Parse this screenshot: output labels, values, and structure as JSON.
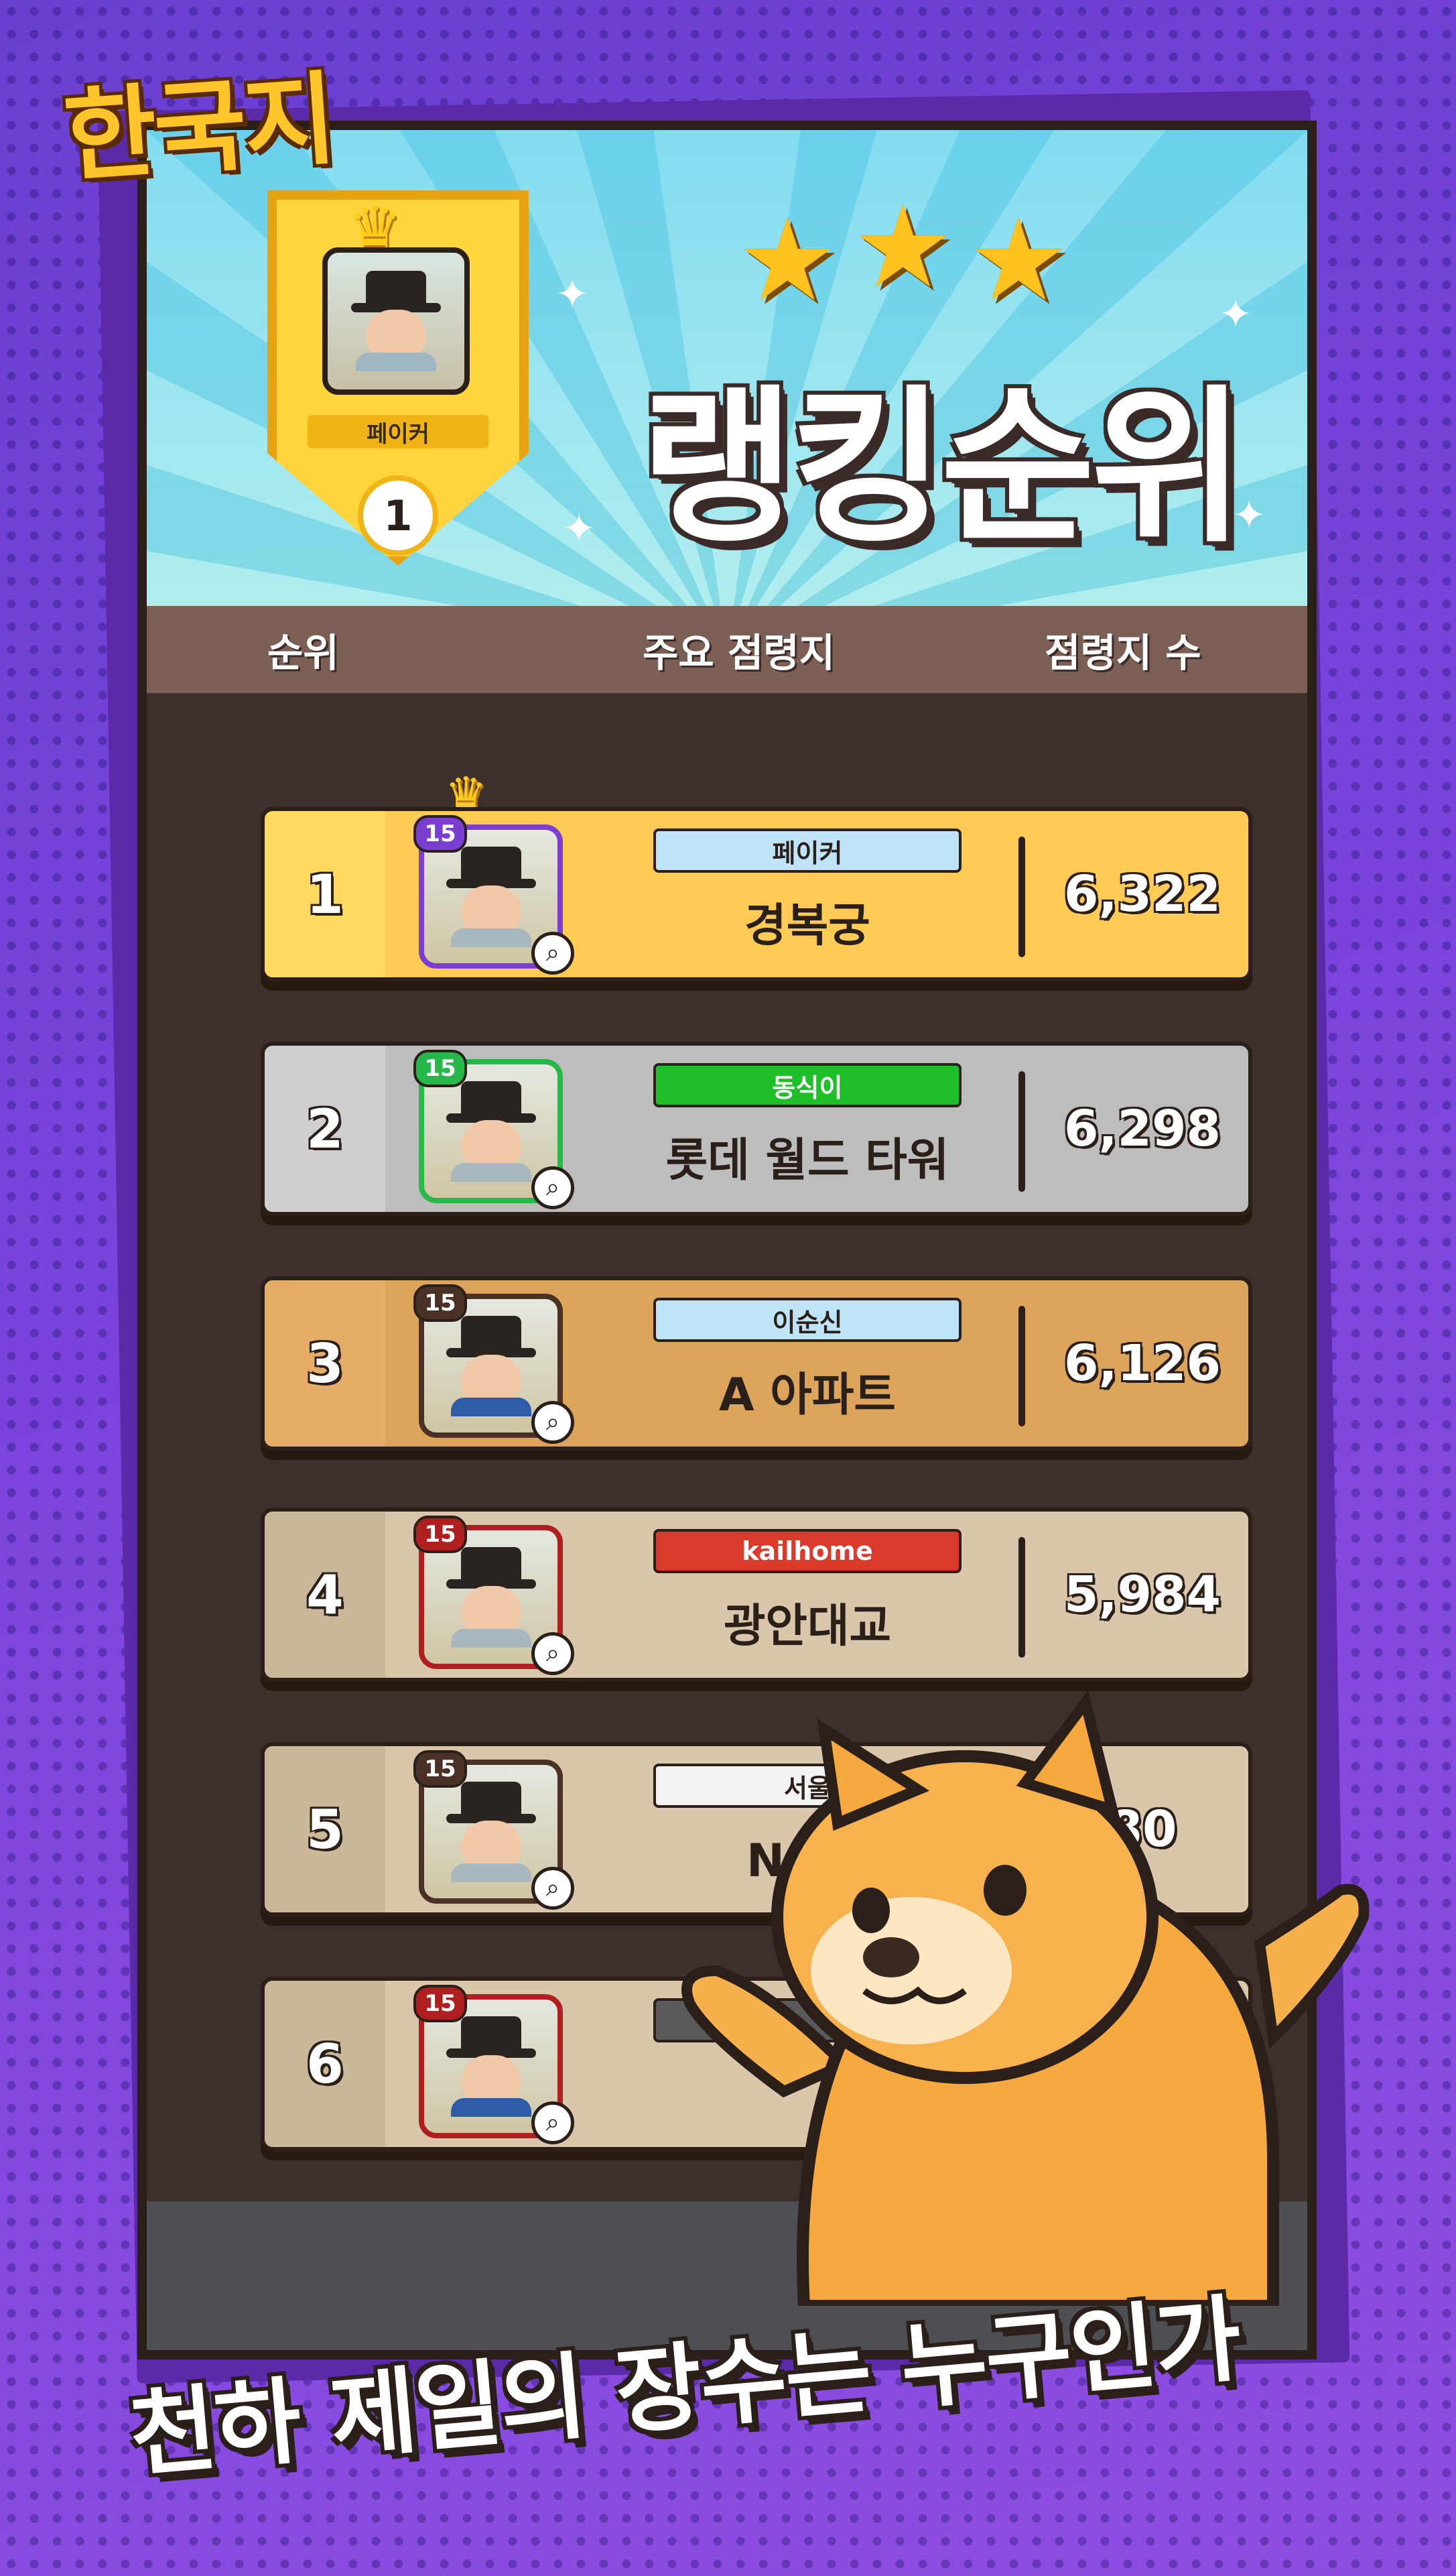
{
  "logo": "한국지",
  "banner": {
    "title": "랭킹순위",
    "top_player": {
      "name": "페이커",
      "rank": "1"
    }
  },
  "columns": {
    "rank": "순위",
    "main_territory": "주요 점령지",
    "territory_count": "점령지 수"
  },
  "rows": [
    {
      "rank": "1",
      "level": "15",
      "name": "페이커",
      "place": "경복궁",
      "count": "6,322",
      "row_color": "#ffcb55",
      "rank_bg": "#ffd960",
      "tag_color": "#bfe3f7",
      "lvl_color": "#7a3fd1"
    },
    {
      "rank": "2",
      "level": "15",
      "name": "동식이",
      "place": "롯데 월드 타워",
      "count": "6,298",
      "row_color": "#bdbdbd",
      "rank_bg": "#cfcfcf",
      "tag_color": "#1fbf2a",
      "lvl_color": "#27b84a"
    },
    {
      "rank": "3",
      "level": "15",
      "name": "이순신",
      "place": "A 아파트",
      "count": "6,126",
      "row_color": "#dda45c",
      "rank_bg": "#e6ad68",
      "tag_color": "#bfe3f7",
      "lvl_color": "#4a3126"
    },
    {
      "rank": "4",
      "level": "15",
      "name": "kailhome",
      "place": "광안대교",
      "count": "5,984",
      "row_color": "#d9c6ab",
      "rank_bg": "#cbb79a",
      "tag_color": "#d93a2b",
      "lvl_color": "#b01f1f"
    },
    {
      "rank": "5",
      "level": "15",
      "name": "서울",
      "place": "N서울",
      "count": "80",
      "row_color": "#d9c6ab",
      "rank_bg": "#cbb79a",
      "tag_color": "#f3f3f3",
      "lvl_color": "#4a3126"
    },
    {
      "rank": "6",
      "level": "15",
      "name": "",
      "place": "",
      "count": "",
      "row_color": "#d9c6ab",
      "rank_bg": "#cbb79a",
      "tag_color": "#5a5a5a",
      "lvl_color": "#b01f1f"
    }
  ],
  "tagline": "천하 제일의 장수는 누구인가",
  "icons": {
    "crown": "crown-icon",
    "star": "star-icon",
    "magnifier": "magnifier-icon",
    "mascot": "shiba-dog-mascot"
  }
}
